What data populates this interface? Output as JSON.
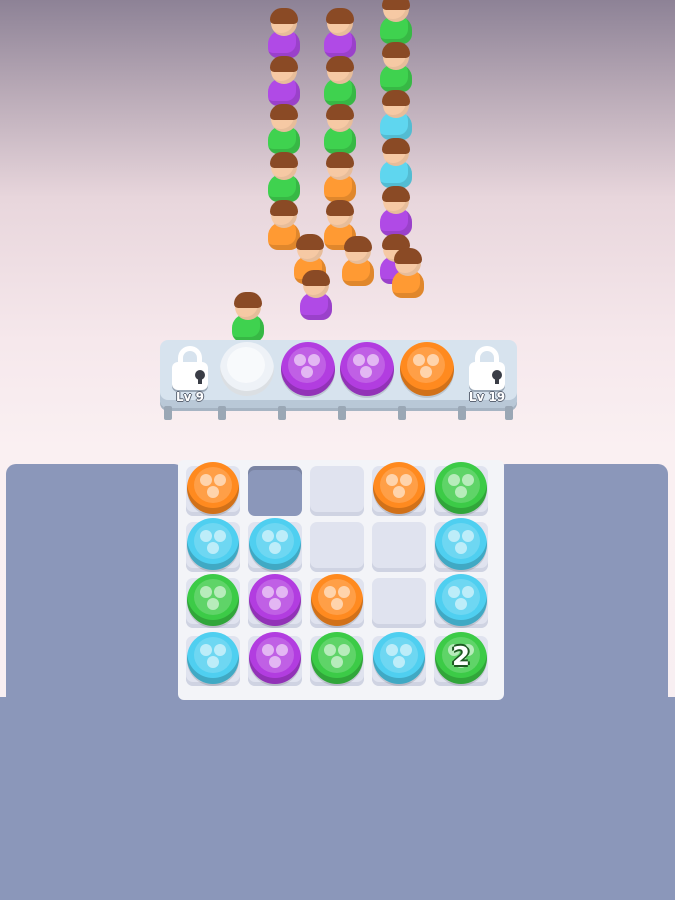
{
  "bench": {
    "left_lock": {
      "label": "Lv 9",
      "icon": "padlock-icon"
    },
    "right_lock": {
      "label": "Lv 19",
      "icon": "padlock-icon"
    },
    "slots": [
      "white",
      "purple",
      "purple",
      "orange"
    ]
  },
  "crowd": {
    "columns": [
      [
        "purple",
        "purple",
        "green",
        "green",
        "orange"
      ],
      [
        "purple",
        "green",
        "green",
        "orange",
        "orange"
      ],
      [
        "green",
        "green",
        "cyan",
        "cyan",
        "purple",
        "purple"
      ]
    ],
    "front": [
      "orange",
      "orange",
      "orange",
      "purple"
    ],
    "active_customer": "green"
  },
  "board": {
    "rows": [
      [
        "orange",
        "hole",
        "empty",
        "orange",
        "green"
      ],
      [
        "cyan",
        "cyan",
        "empty",
        "empty",
        "cyan"
      ],
      [
        "green",
        "purple",
        "orange",
        "empty",
        "cyan"
      ],
      [
        "cyan",
        "purple",
        "green",
        "cyan",
        "green"
      ]
    ],
    "stack_count": "2"
  },
  "colors": {
    "orange": "#ff8a1f",
    "cyan": "#4fcff0",
    "green": "#3ccb47",
    "purple": "#b23de0",
    "panel": "#8b97ba"
  }
}
